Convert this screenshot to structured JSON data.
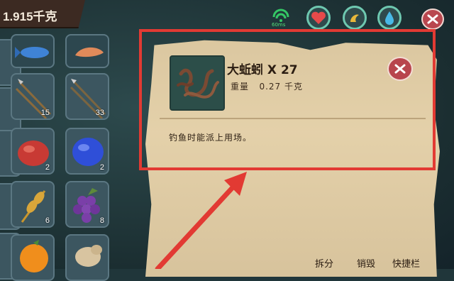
{
  "hud": {
    "carry_weight": "1.915千克",
    "signal_text": "60ms"
  },
  "inventory": {
    "slots": [
      {
        "name": "blue-fish-slot",
        "count": ""
      },
      {
        "name": "shrimp-slot",
        "count": ""
      },
      {
        "name": "spear-slot",
        "count": "15"
      },
      {
        "name": "spear-slot-2",
        "count": "33"
      },
      {
        "name": "red-fruit-slot",
        "count": "2"
      },
      {
        "name": "blue-fruit-slot",
        "count": "2"
      },
      {
        "name": "wheat-slot",
        "count": "6"
      },
      {
        "name": "grapes-slot",
        "count": "8"
      },
      {
        "name": "orange-slot",
        "count": ""
      },
      {
        "name": "ginger-slot",
        "count": ""
      }
    ]
  },
  "detail": {
    "title": "大蚯蚓 X 27",
    "weight_label": "重量",
    "weight_value": "0.27 千克",
    "description": "钓鱼时能派上用场。",
    "actions": {
      "split": "拆分",
      "destroy": "销毁",
      "quickbar": "快捷栏"
    }
  },
  "colors": {
    "highlight": "#e23a33",
    "close_button": "#b8454d",
    "parchment": "#e6d3ac"
  }
}
